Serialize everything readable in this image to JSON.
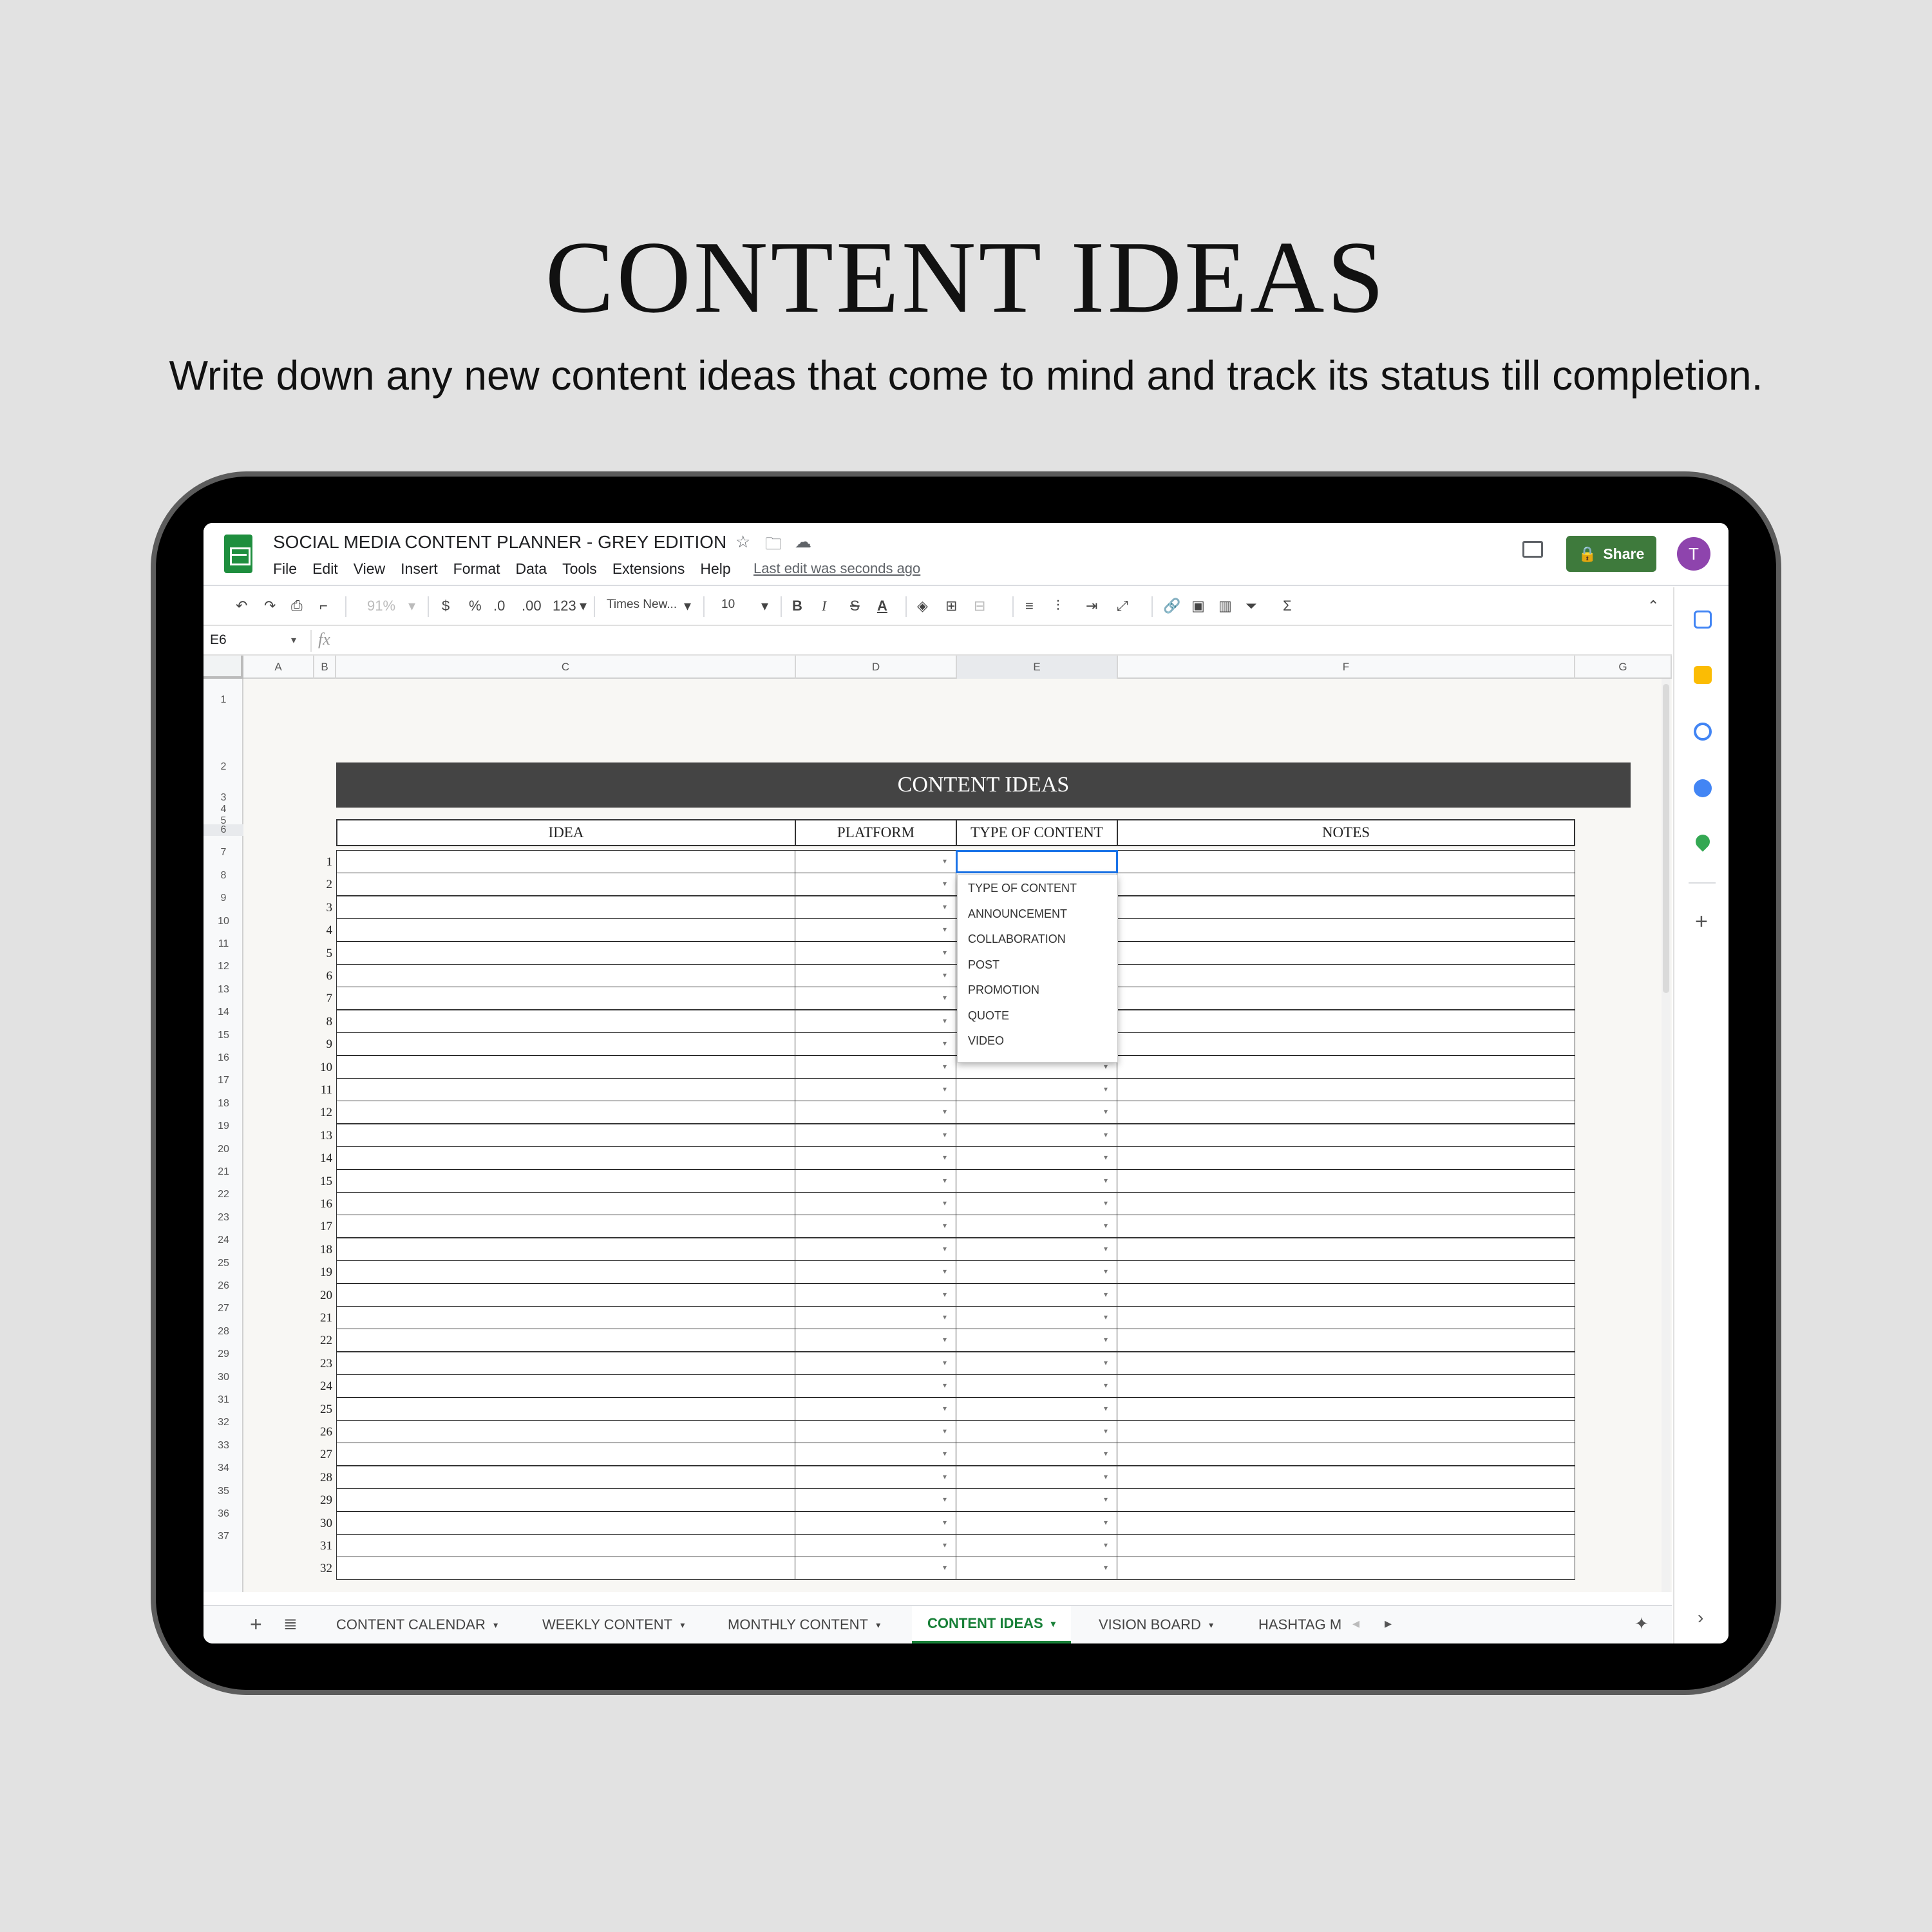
{
  "hero": {
    "title": "CONTENT IDEAS",
    "subtitle": "Write down any new content ideas that come to mind and track its status till completion."
  },
  "app": {
    "doc_title": "SOCIAL MEDIA CONTENT PLANNER - GREY EDITION",
    "menu": [
      "File",
      "Edit",
      "View",
      "Insert",
      "Format",
      "Data",
      "Tools",
      "Extensions",
      "Help"
    ],
    "last_edit": "Last edit was seconds ago",
    "share_label": "Share",
    "avatar_initial": "T"
  },
  "toolbar": {
    "zoom": "91%",
    "currency": "$",
    "percent": "%",
    "dec_less": ".0",
    "dec_more": ".00",
    "format_more": "123",
    "font": "Times New...",
    "font_size": "10",
    "bold": "B",
    "italic": "I",
    "strike": "S",
    "text_color": "A",
    "sum": "Σ"
  },
  "formula_bar": {
    "cell_ref": "E6",
    "fx": "fx"
  },
  "columns": [
    "A",
    "B",
    "C",
    "D",
    "E",
    "F",
    "G"
  ],
  "row_numbers": [
    "1",
    "2",
    "3",
    "4",
    "5",
    "6",
    "7",
    "8",
    "9",
    "10",
    "11",
    "12",
    "13",
    "14",
    "15",
    "16",
    "17",
    "18",
    "19",
    "20",
    "21",
    "22",
    "23",
    "24",
    "25",
    "26",
    "27",
    "28",
    "29",
    "30",
    "31",
    "32",
    "33",
    "34",
    "35",
    "36",
    "37"
  ],
  "sheet": {
    "banner": "CONTENT IDEAS",
    "headers": [
      "IDEA",
      "PLATFORM",
      "TYPE OF CONTENT",
      "NOTES"
    ],
    "entry_numbers": [
      "1",
      "2",
      "3",
      "4",
      "5",
      "6",
      "7",
      "8",
      "9",
      "10",
      "11",
      "12",
      "13",
      "14",
      "15",
      "16",
      "17",
      "18",
      "19",
      "20",
      "21",
      "22",
      "23",
      "24",
      "25",
      "26",
      "27",
      "28",
      "29",
      "30",
      "31",
      "32"
    ]
  },
  "dropdown_options": [
    "TYPE OF CONTENT",
    "ANNOUNCEMENT",
    "COLLABORATION",
    "POST",
    "PROMOTION",
    "QUOTE",
    "VIDEO"
  ],
  "tabs": [
    "CONTENT CALENDAR",
    "WEEKLY CONTENT",
    "MONTHLY CONTENT",
    "CONTENT IDEAS",
    "VISION BOARD",
    "HASHTAG M"
  ],
  "active_tab": "CONTENT IDEAS",
  "colors": {
    "background": "#e2e2e2",
    "banner": "#444444",
    "share": "#3e7a3c",
    "active_tab": "#188038",
    "selection": "#1a73e8"
  }
}
